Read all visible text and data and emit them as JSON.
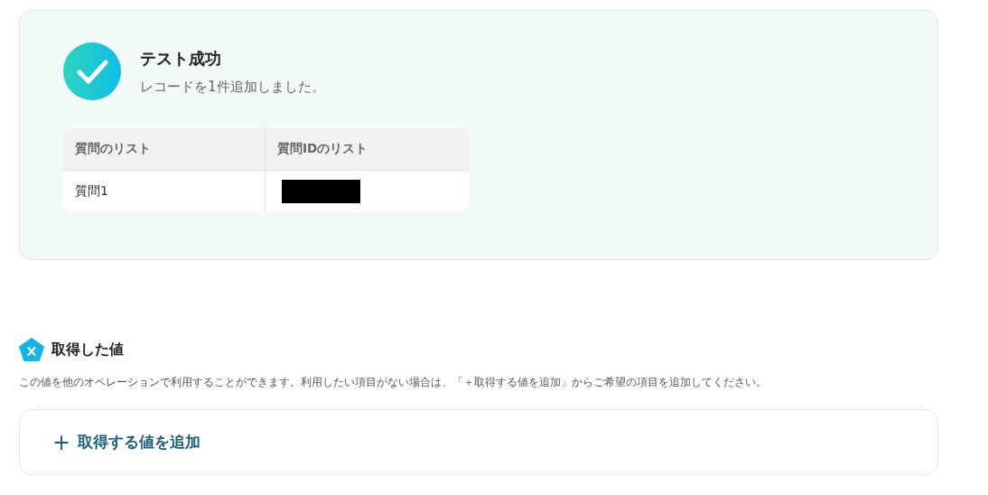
{
  "result": {
    "success": true,
    "title": "テスト成功",
    "message": "レコードを1件追加しました。",
    "table": {
      "columns": [
        "質問のリスト",
        "質問IDのリスト"
      ],
      "rows": [
        {
          "cells": [
            {
              "text": "質問1"
            },
            {
              "redacted": true
            }
          ]
        }
      ]
    }
  },
  "values_section": {
    "title": "取得した値",
    "description": "この値を他のオペレーションで利用することができます。利用したい項目がない場合は、「＋取得する値を追加」からご希望の項目を追加してください。",
    "add_button": {
      "icon": "+",
      "label": "取得する値を追加"
    }
  }
}
